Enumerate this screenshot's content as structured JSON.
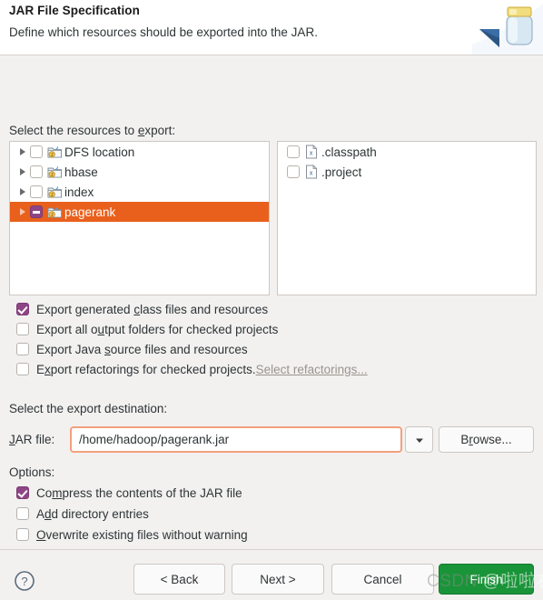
{
  "header": {
    "title": "JAR File Specification",
    "description": "Define which resources should be exported into the JAR.",
    "icon": "jar-bottle-icon"
  },
  "resources": {
    "label": "Select the resources to export:",
    "label_mnemonic": "e",
    "left_tree": {
      "items": [
        {
          "label": "DFS location",
          "checked": "unchecked",
          "selected": false,
          "expandable": true,
          "icon": "java-project-icon"
        },
        {
          "label": "hbase",
          "checked": "unchecked",
          "selected": false,
          "expandable": true,
          "icon": "java-project-icon"
        },
        {
          "label": "index",
          "checked": "unchecked",
          "selected": false,
          "expandable": true,
          "icon": "java-project-icon"
        },
        {
          "label": "pagerank",
          "checked": "partial",
          "selected": true,
          "expandable": true,
          "icon": "java-project-icon"
        }
      ]
    },
    "right_tree": {
      "items": [
        {
          "label": ".classpath",
          "checked": "unchecked",
          "icon": "xml-file-icon"
        },
        {
          "label": ".project",
          "checked": "unchecked",
          "icon": "xml-file-icon"
        }
      ]
    }
  },
  "export_options": [
    {
      "label": "Export generated class files and resources",
      "checked": true
    },
    {
      "label": "Export all output folders for checked projects",
      "checked": false
    },
    {
      "label": "Export Java source files and resources",
      "checked": false
    },
    {
      "label": "Export refactorings for checked projects.",
      "checked": false,
      "link": "Select refactorings..."
    }
  ],
  "destination": {
    "label": "Select the export destination:",
    "jar_file_label": "JAR file:",
    "jar_file_value": "/home/hadoop/pagerank.jar",
    "dropdown_icon": "chevron-down-icon",
    "browse_label": "Browse..."
  },
  "options": {
    "label": "Options:",
    "items": [
      {
        "label": "Compress the contents of the JAR file",
        "checked": true
      },
      {
        "label": "Add directory entries",
        "checked": false
      },
      {
        "label": "Overwrite existing files without warning",
        "checked": false
      }
    ]
  },
  "footer": {
    "help_icon": "help-question-icon",
    "back_label": "< Back",
    "next_label": "Next >",
    "cancel_label": "Cancel",
    "finish_label": "Finish"
  },
  "watermark": {
    "prefix": "CSDN",
    "handle": "@啦啦右一"
  },
  "colors": {
    "selection": "#e8601c",
    "checkbox_checked": "#8e4585",
    "finish_button": "#1a9439",
    "focus_border": "#f2a07e"
  }
}
